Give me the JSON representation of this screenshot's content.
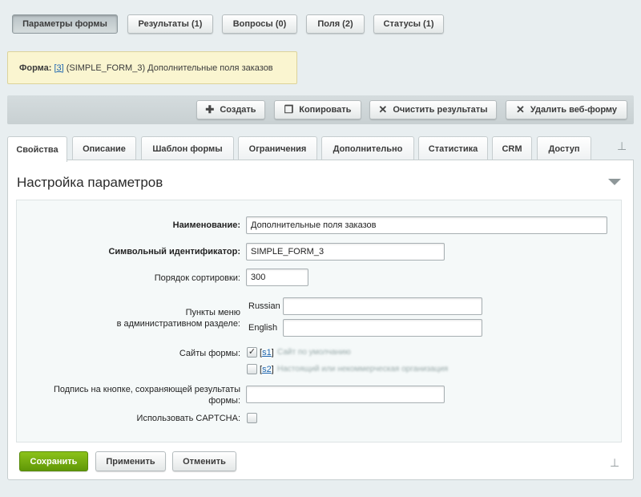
{
  "top_tabs": [
    "Параметры формы",
    "Результаты (1)",
    "Вопросы (0)",
    "Поля (2)",
    "Статусы (1)"
  ],
  "notice": {
    "label": "Форма:",
    "id_link": "[3]",
    "text": "(SIMPLE_FORM_3) Дополнительные поля заказов"
  },
  "toolbar": {
    "create": "Создать",
    "copy": "Копировать",
    "clear": "Очистить результаты",
    "delete": "Удалить веб-форму"
  },
  "tabs": [
    "Свойства",
    "Описание",
    "Шаблон формы",
    "Ограничения",
    "Дополнительно",
    "Статистика",
    "CRM",
    "Доступ"
  ],
  "panel": {
    "title": "Настройка параметров"
  },
  "form": {
    "name_label": "Наименование:",
    "name_value": "Дополнительные поля заказов",
    "sid_label": "Символьный идентификатор:",
    "sid_value": "SIMPLE_FORM_3",
    "sort_label": "Порядок сортировки:",
    "sort_value": "300",
    "menu_label_1": "Пункты меню",
    "menu_label_2": "в административном разделе:",
    "menu_ru": "Russian",
    "menu_en": "English",
    "sites_label": "Сайты формы:",
    "site1_link": "s1",
    "site1_name": "Сайт по умолчанию",
    "site2_link": "s2",
    "site2_name": "Настоящий или некоммерческая организация",
    "button_caption_label_1": "Подпись на кнопке, сохраняющей результаты",
    "button_caption_label_2": "формы:",
    "captcha_label": "Использовать CAPTCHA:"
  },
  "footer": {
    "save": "Сохранить",
    "apply": "Применить",
    "cancel": "Отменить"
  },
  "colors": {
    "save_green": "#6ea10f",
    "link": "#2067b0"
  }
}
